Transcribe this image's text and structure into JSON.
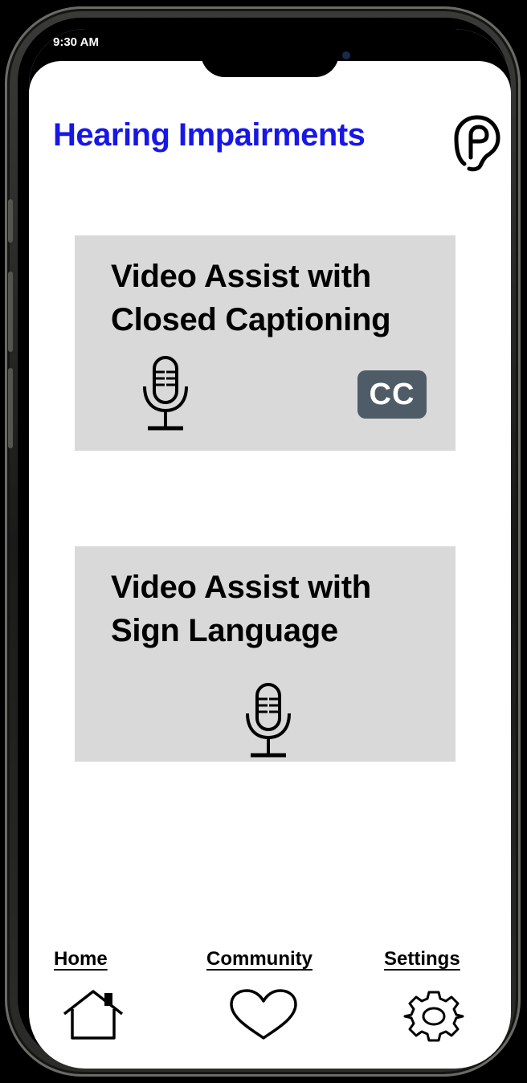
{
  "status_bar": {
    "time": "9:30 AM"
  },
  "header": {
    "title": "Hearing Impairments"
  },
  "cards": [
    {
      "title_line1": "Video Assist with",
      "title_line2": "Closed Captioning",
      "icons": [
        "microphone-icon",
        "cc-icon"
      ],
      "badge": "CC"
    },
    {
      "title_line1": "Video Assist with",
      "title_line2": "Sign Language",
      "icons": [
        "microphone-icon"
      ]
    }
  ],
  "nav": {
    "items": [
      {
        "label": "Home",
        "icon": "home-icon"
      },
      {
        "label": "Community",
        "icon": "heart-icon"
      },
      {
        "label": "Settings",
        "icon": "gear-icon"
      }
    ]
  },
  "colors": {
    "title": "#1717e6",
    "card_background": "#d9d9d9",
    "cc_badge": "#4f5c67"
  }
}
